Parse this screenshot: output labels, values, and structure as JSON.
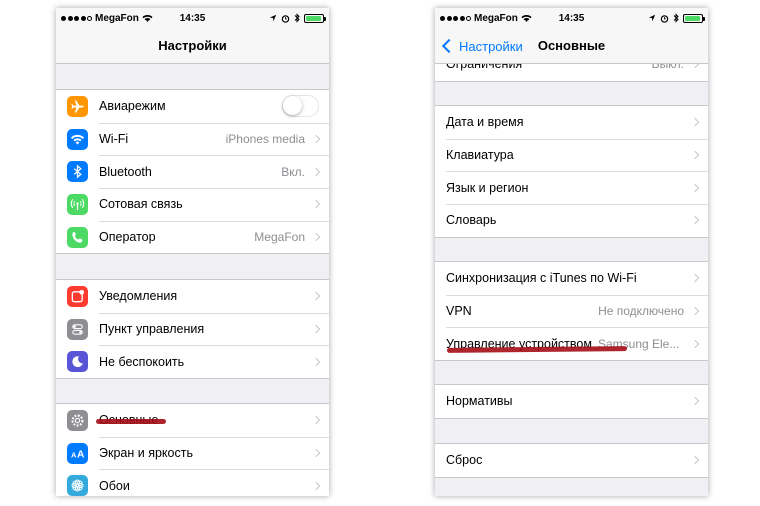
{
  "status_bar": {
    "carrier": "MegaFon",
    "time": "14:35",
    "battery_level": 0.95
  },
  "left_screen": {
    "title": "Настройки",
    "groups": [
      {
        "items": [
          {
            "label": "Авиарежим",
            "value": "",
            "icon": "airplane-icon",
            "color": "#ff9500",
            "toggle": true
          },
          {
            "label": "Wi-Fi",
            "value": "iPhones media",
            "icon": "wifi-icon",
            "color": "#007aff"
          },
          {
            "label": "Bluetooth",
            "value": "Вкл.",
            "icon": "bluetooth-icon",
            "color": "#007aff"
          },
          {
            "label": "Сотовая связь",
            "value": "",
            "icon": "cellular-icon",
            "color": "#4cd964"
          },
          {
            "label": "Оператор",
            "value": "MegaFon",
            "icon": "phone-icon",
            "color": "#4cd964"
          }
        ]
      },
      {
        "items": [
          {
            "label": "Уведомления",
            "value": "",
            "icon": "notifications-icon",
            "color": "#ff3b30"
          },
          {
            "label": "Пункт управления",
            "value": "",
            "icon": "control-center-icon",
            "color": "#8e8e93"
          },
          {
            "label": "Не беспокоить",
            "value": "",
            "icon": "moon-icon",
            "color": "#5856d6"
          }
        ]
      },
      {
        "items": [
          {
            "label": "Основные",
            "value": "",
            "icon": "gear-icon",
            "color": "#8e8e93"
          },
          {
            "label": "Экран и яркость",
            "value": "",
            "icon": "display-brightness-icon",
            "color": "#007aff"
          },
          {
            "label": "Обои",
            "value": "",
            "icon": "wallpaper-icon",
            "color": "#34aadc"
          }
        ]
      }
    ]
  },
  "right_screen": {
    "back_label": "Настройки",
    "title": "Основные",
    "top_cut_label": "Ограничения",
    "top_cut_value": "Выкл.",
    "groups": [
      {
        "items": [
          {
            "label": "Дата и время",
            "value": ""
          },
          {
            "label": "Клавиатура",
            "value": ""
          },
          {
            "label": "Язык и регион",
            "value": ""
          },
          {
            "label": "Словарь",
            "value": ""
          }
        ]
      },
      {
        "items": [
          {
            "label": "Синхронизация с iTunes по Wi-Fi",
            "value": ""
          },
          {
            "label": "VPN",
            "value": "Не подключено"
          },
          {
            "label": "Управление устройством",
            "value": "Samsung Ele..."
          }
        ]
      },
      {
        "items": [
          {
            "label": "Нормативы",
            "value": ""
          }
        ]
      },
      {
        "items": [
          {
            "label": "Сброс",
            "value": ""
          }
        ]
      }
    ]
  }
}
